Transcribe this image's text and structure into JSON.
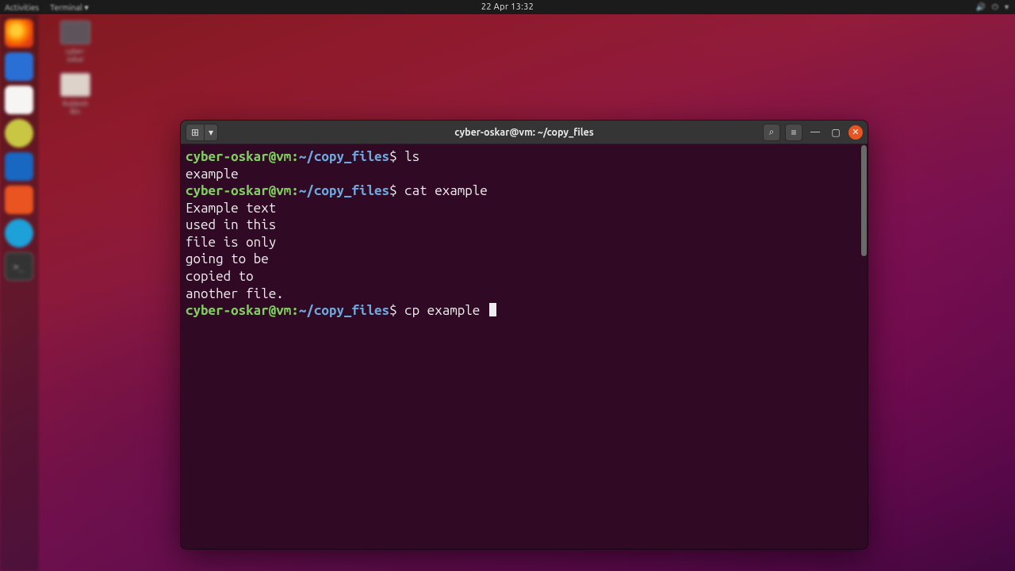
{
  "topbar": {
    "activities": "Activities",
    "app_menu": "Terminal ▾",
    "clock": "22 Apr  13:32",
    "indicators": [
      "🔊",
      "⏻",
      "▾"
    ]
  },
  "desktop_icons": {
    "i1": "cyber-oskar",
    "i2": "Rubbish Bin"
  },
  "terminal": {
    "title": "cyber-oskar@vm: ~/copy_files",
    "new_tab_glyph": "⊞",
    "dropdown_glyph": "▾",
    "search_glyph": "⌕",
    "menu_glyph": "≡",
    "min_glyph": "—",
    "max_glyph": "▢",
    "close_glyph": "✕",
    "prompt": {
      "user": "cyber-oskar@vm",
      "colon": ":",
      "path": "~/copy_files",
      "dollar": "$ "
    },
    "cmd1": "ls",
    "out1": "example",
    "cmd2": "cat example",
    "out2a": "Example text",
    "out2b": "used in this",
    "out2c": "file is only",
    "out2d": "going to be",
    "out2e": "copied to",
    "out2f": "another file.",
    "cmd3": "cp example "
  }
}
